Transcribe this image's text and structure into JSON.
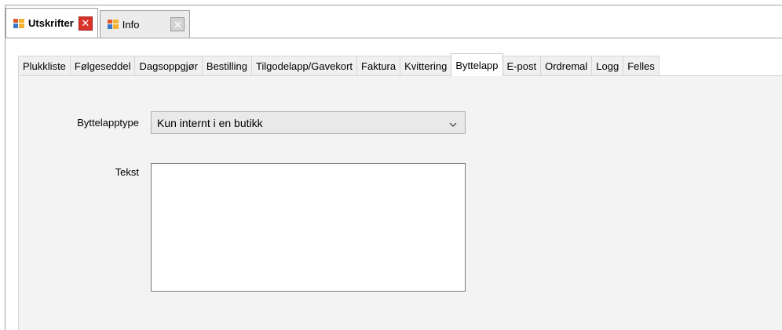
{
  "document_tabs": [
    {
      "label": "Utskrifter",
      "active": true,
      "icon": "form-window-icon",
      "close_icon": "close-icon"
    },
    {
      "label": "Info",
      "active": false,
      "icon": "form-window-icon",
      "close_icon": "close-icon"
    }
  ],
  "tabs": [
    {
      "label": "Plukkliste"
    },
    {
      "label": "Følgeseddel"
    },
    {
      "label": "Dagsoppgjør"
    },
    {
      "label": "Bestilling"
    },
    {
      "label": "Tilgodelapp/Gavekort"
    },
    {
      "label": "Faktura"
    },
    {
      "label": "Kvittering"
    },
    {
      "label": "Byttelapp",
      "selected": true
    },
    {
      "label": "E-post"
    },
    {
      "label": "Ordremal"
    },
    {
      "label": "Logg"
    },
    {
      "label": "Felles"
    }
  ],
  "form": {
    "type_label": "Byttelapptype",
    "type_value": "Kun internt i en butikk",
    "text_label": "Tekst",
    "text_value": ""
  },
  "colors": {
    "close_active": "#d9342b",
    "close_inactive": "#d3d3d3",
    "panel_bg": "#f3f3f3"
  }
}
